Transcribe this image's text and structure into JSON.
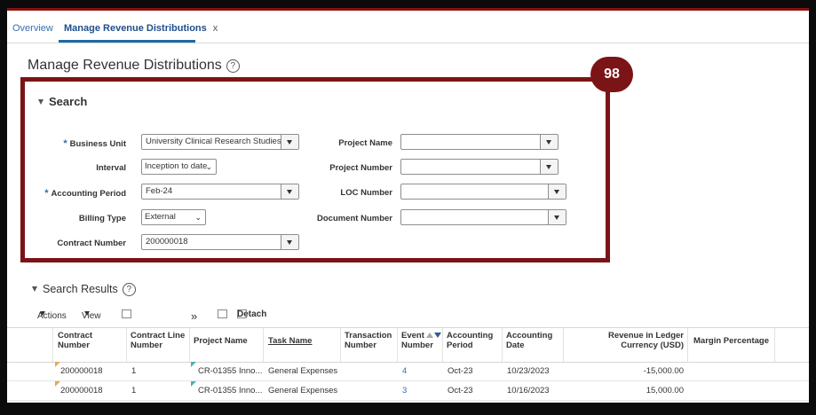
{
  "tabs": {
    "overview": "Overview",
    "active": "Manage Revenue Distributions",
    "close": "x"
  },
  "page_title": "Manage Revenue Distributions",
  "help_glyph": "?",
  "callout_number": "98",
  "search": {
    "heading": "Search",
    "required_mark": "*",
    "business_unit": {
      "label": "Business Unit",
      "value": "University Clinical Research Studies"
    },
    "interval": {
      "label": "Interval",
      "value": "Inception to date"
    },
    "accounting_period": {
      "label": "Accounting Period",
      "value": "Feb-24"
    },
    "billing_type": {
      "label": "Billing Type",
      "value": "External"
    },
    "contract_number": {
      "label": "Contract Number",
      "value": "200000018"
    },
    "project_name": {
      "label": "Project Name",
      "value": ""
    },
    "project_number": {
      "label": "Project Number",
      "value": ""
    },
    "loc_number": {
      "label": "LOC Number",
      "value": ""
    },
    "document_number": {
      "label": "Document Number",
      "value": ""
    }
  },
  "results": {
    "heading": "Search Results",
    "toolbar": {
      "actions": "Actions",
      "view": "View",
      "more": "»",
      "detach": "Detach"
    },
    "columns": [
      {
        "l1": "Contract",
        "l2": "Number"
      },
      {
        "l1": "Contract Line",
        "l2": "Number"
      },
      {
        "l1": "Project Name",
        "l2": ""
      },
      {
        "l1": "Task Name",
        "l2": ""
      },
      {
        "l1": "Transaction",
        "l2": "Number"
      },
      {
        "l1": "Event",
        "l2": "Number"
      },
      {
        "l1": "Accounting",
        "l2": "Period"
      },
      {
        "l1": "Accounting",
        "l2": "Date"
      },
      {
        "l1": "Revenue in Ledger",
        "l2": "Currency (USD)"
      },
      {
        "l1": "Margin Percentage",
        "l2": ""
      }
    ],
    "rows": [
      {
        "contract": "200000018",
        "line": "1",
        "project": "CR-01355 Inno...",
        "task": "General Expenses",
        "event": "4",
        "period": "Oct-23",
        "date": "10/23/2023",
        "revenue": "-15,000.00"
      },
      {
        "contract": "200000018",
        "line": "1",
        "project": "CR-01355 Inno...",
        "task": "General Expenses",
        "event": "3",
        "period": "Oct-23",
        "date": "10/16/2023",
        "revenue": "15,000.00"
      }
    ]
  },
  "colors": {
    "accent": "#1f6aa5",
    "callout": "#7b1416",
    "link": "#2f6fb2"
  }
}
